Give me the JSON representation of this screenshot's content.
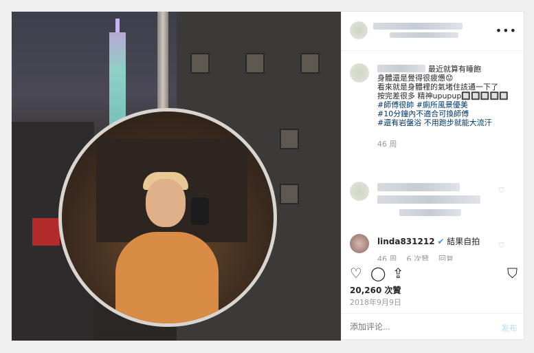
{
  "caption": {
    "line1": "最近就算有睡飽",
    "line2": "身體還是覺得很疲憊😟",
    "line3": "看來就是身體裡的氣堵住該通一下了",
    "line4": "按完差很多 精神upupup🔲🔲🔲🔲🔲",
    "tag1": "#師傅很帥 #廁所風景優美",
    "tag2": "#10分鐘內不適合可換師傅",
    "tag3": "#還有岩盤浴 不用跑步就能大流汗",
    "time": "46 周"
  },
  "comments": [
    {
      "username": "linda831212",
      "text": "結果自拍",
      "time": "46 周",
      "likes": "6 次贊",
      "reply": "回复"
    }
  ],
  "stats": {
    "likes": "20,260 次贊",
    "date": "2018年9月9日"
  },
  "add_comment": {
    "placeholder": "添加评论...",
    "post_label": "发布"
  },
  "icons": {
    "more": "more-icon",
    "heart": "heart-icon",
    "comment": "comment-icon",
    "share": "share-icon",
    "bookmark": "bookmark-icon"
  }
}
